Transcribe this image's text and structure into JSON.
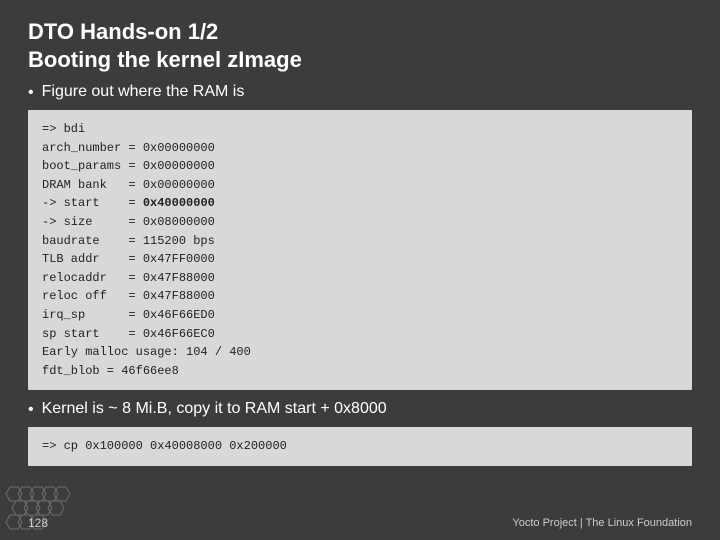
{
  "header": {
    "title_line1": "DTO Hands-on 1/2",
    "title_line2": "Booting the kernel zImage"
  },
  "bullet1": {
    "text": "Figure out where the RAM is"
  },
  "code_block1": {
    "lines": [
      {
        "label": "=> bdi",
        "value": "",
        "bold": false
      },
      {
        "label": "arch_number = ",
        "value": "0x00000000",
        "bold": false
      },
      {
        "label": "boot_params = ",
        "value": "0x00000000",
        "bold": false
      },
      {
        "label": "DRAM bank   = ",
        "value": "0x00000000",
        "bold": false
      },
      {
        "label": "-> start    = ",
        "value": "0x40000000",
        "bold": true
      },
      {
        "label": "-> size     = ",
        "value": "0x08000000",
        "bold": false
      },
      {
        "label": "baudrate    = ",
        "value": "115200 bps",
        "bold": false
      },
      {
        "label": "TLB addr    = ",
        "value": "0x47FF0000",
        "bold": false
      },
      {
        "label": "relocaddr   = ",
        "value": "0x47F88000",
        "bold": false
      },
      {
        "label": "reloc off   = ",
        "value": "0x47F88000",
        "bold": false
      },
      {
        "label": "irq_sp      = ",
        "value": "0x46F66ED0",
        "bold": false
      },
      {
        "label": "sp start    = ",
        "value": "0x46F66EC0",
        "bold": false
      },
      {
        "label": "Early malloc usage: 104 / 400",
        "value": "",
        "bold": false
      },
      {
        "label": "fdt_blob = 46f66ee8",
        "value": "",
        "bold": false
      }
    ]
  },
  "bullet2": {
    "text": "Kernel is ~ 8 Mi.B, copy it to RAM start + 0x8000"
  },
  "code_block2": {
    "line": "=> cp 0x100000  0x40008000  0x200000"
  },
  "footer": {
    "page": "128",
    "brand": "Yocto Project | The Linux Foundation"
  }
}
